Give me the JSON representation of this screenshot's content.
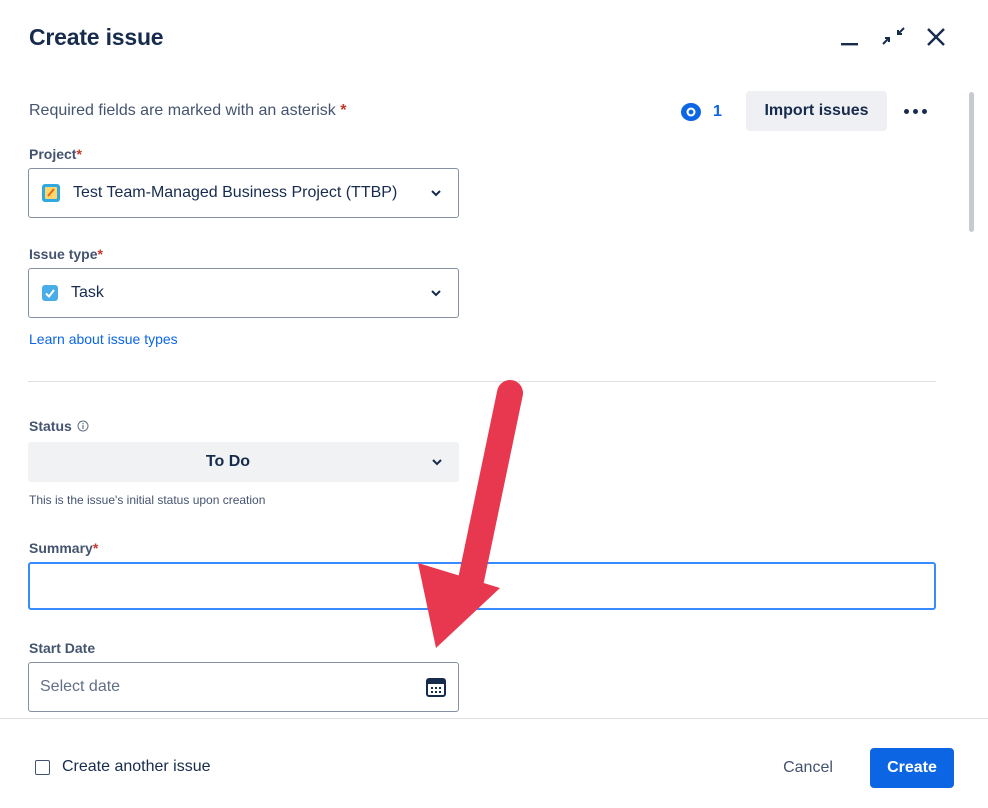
{
  "dialog": {
    "title": "Create issue"
  },
  "header_controls": {
    "minimize_icon": "minimize-icon",
    "collapse_icon": "collapse-arrows-icon",
    "close_icon": "close-icon"
  },
  "toolbar": {
    "required_note": "Required fields are marked with an asterisk",
    "asterisk": "*",
    "watchers_count": "1",
    "import_label": "Import issues",
    "more_icon": "more-horizontal-icon"
  },
  "fields": {
    "project": {
      "label": "Project",
      "required_mark": "*",
      "value": "Test Team-Managed Business Project (TTBP)",
      "icon": "project-notebook-icon"
    },
    "issue_type": {
      "label": "Issue type",
      "required_mark": "*",
      "value": "Task",
      "icon": "task-checkbox-icon",
      "help_link": "Learn about issue types"
    },
    "status": {
      "label": "Status",
      "info_icon": "info-icon",
      "value": "To Do",
      "helper": "This is the issue's initial status upon creation"
    },
    "summary": {
      "label": "Summary",
      "required_mark": "*",
      "value": ""
    },
    "start_date": {
      "label": "Start Date",
      "placeholder": "Select date",
      "icon": "calendar-icon"
    }
  },
  "footer": {
    "create_another_label": "Create another issue",
    "create_another_checked": false,
    "cancel_label": "Cancel",
    "create_label": "Create"
  },
  "colors": {
    "accent": "#0c66e4",
    "required": "#c9372c",
    "annotation_arrow": "#e8384f"
  }
}
